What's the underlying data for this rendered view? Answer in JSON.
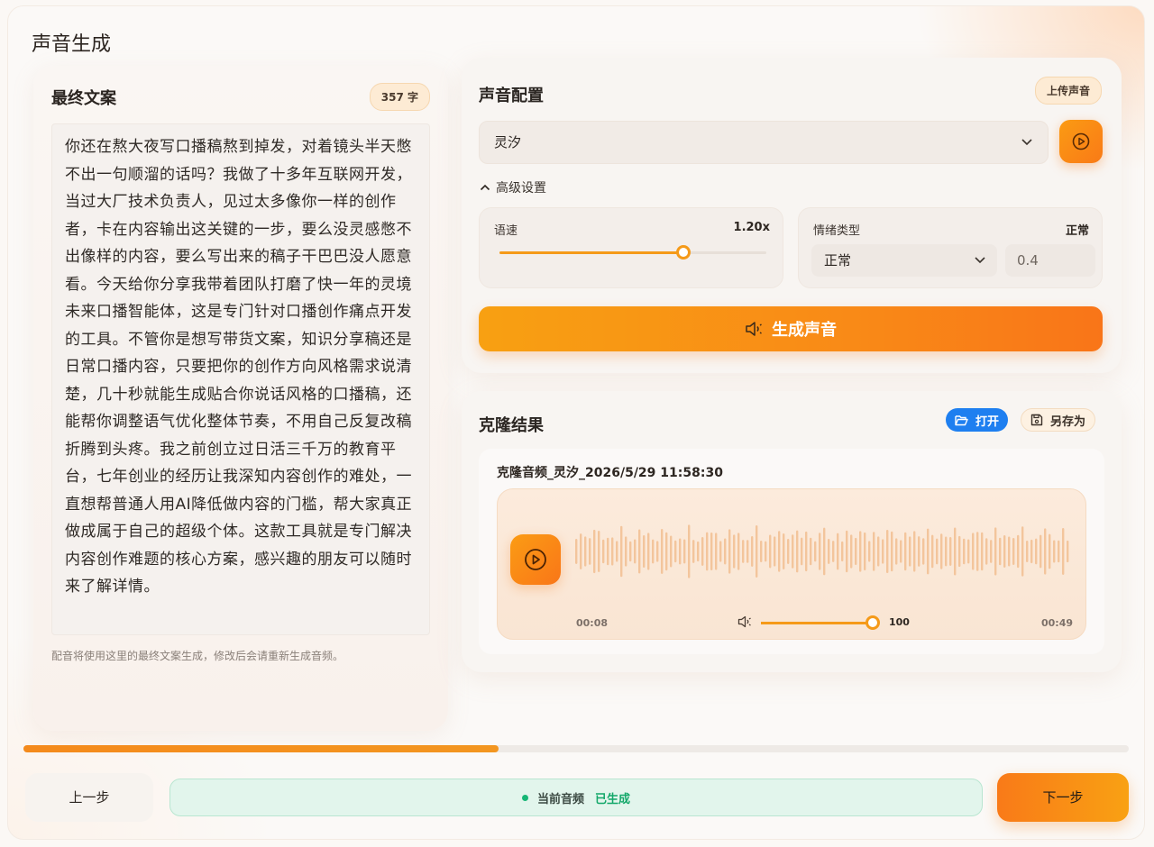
{
  "page": {
    "title": "声音生成"
  },
  "script_panel": {
    "title": "最终文案",
    "char_count": "357 字",
    "text": "你还在熬大夜写口播稿熬到掉发，对着镜头半天憋不出一句顺溜的话吗？我做了十多年互联网开发，当过大厂技术负责人，见过太多像你一样的创作者，卡在内容输出这关键的一步，要么没灵感憋不出像样的内容，要么写出来的稿子干巴巴没人愿意看。今天给你分享我带着团队打磨了快一年的灵境未来口播智能体，这是专门针对口播创作痛点开发的工具。不管你是想写带货文案，知识分享稿还是日常口播内容，只要把你的创作方向风格需求说清楚，几十秒就能生成贴合你说话风格的口播稿，还能帮你调整语气优化整体节奏，不用自己反复改稿折腾到头疼。我之前创立过日活三千万的教育平台，七年创业的经历让我深知内容创作的难处，一直想帮普通人用AI降低做内容的门槛，帮大家真正做成属于自己的超级个体。这款工具就是专门解决内容创作难题的核心方案，感兴趣的朋友可以随时来了解详情。",
    "note": "配音将使用这里的最终文案生成，修改后会请重新生成音频。"
  },
  "voice_config": {
    "title": "声音配置",
    "upload_label": "上传声音",
    "selected_voice": "灵汐",
    "advanced_label": "高级设置",
    "speed": {
      "label": "语速",
      "value": "1.20x",
      "level": 0.69
    },
    "emotion": {
      "label": "情绪类型",
      "value": "正常",
      "selected": "正常",
      "weight": "0.4"
    },
    "generate_label": "生成声音"
  },
  "clone_result": {
    "title": "克隆结果",
    "open_label": "打开",
    "save_as_label": "另存为",
    "file_title": "克隆音频_灵汐_2026/5/29 11:58:30",
    "current_time": "00:08",
    "duration": "00:49",
    "volume": "100",
    "volume_level": 1.0
  },
  "footer": {
    "progress": 0.43,
    "prev_label": "上一步",
    "status_label": "当前音频",
    "status_value": "已生成",
    "next_label": "下一步"
  },
  "colors": {
    "accent": "#f98a17",
    "blue": "#1e7ff0",
    "success": "#14a86a"
  }
}
